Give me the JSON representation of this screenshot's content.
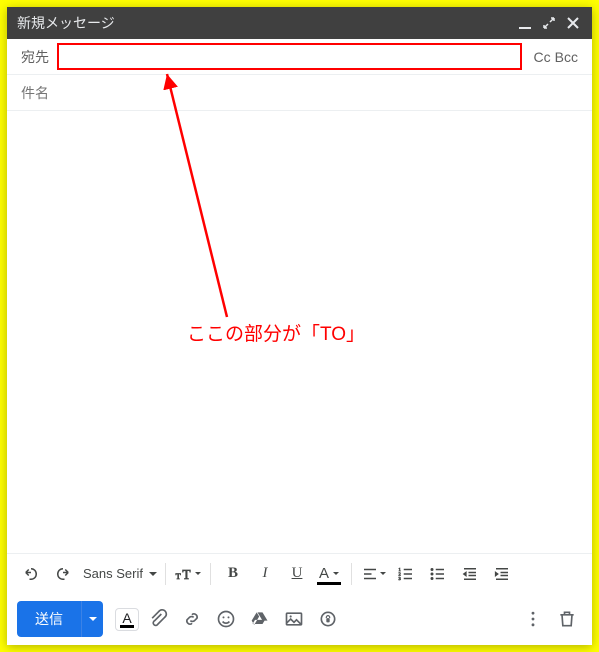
{
  "window": {
    "title": "新規メッセージ"
  },
  "recipients": {
    "to_label": "宛先",
    "to_value": "",
    "cc_label": "Cc",
    "bcc_label": "Bcc"
  },
  "subject": {
    "placeholder": "件名"
  },
  "toolbar": {
    "font_name": "Sans Serif"
  },
  "send": {
    "label": "送信"
  },
  "annotation": {
    "text": "ここの部分が「TO」"
  }
}
